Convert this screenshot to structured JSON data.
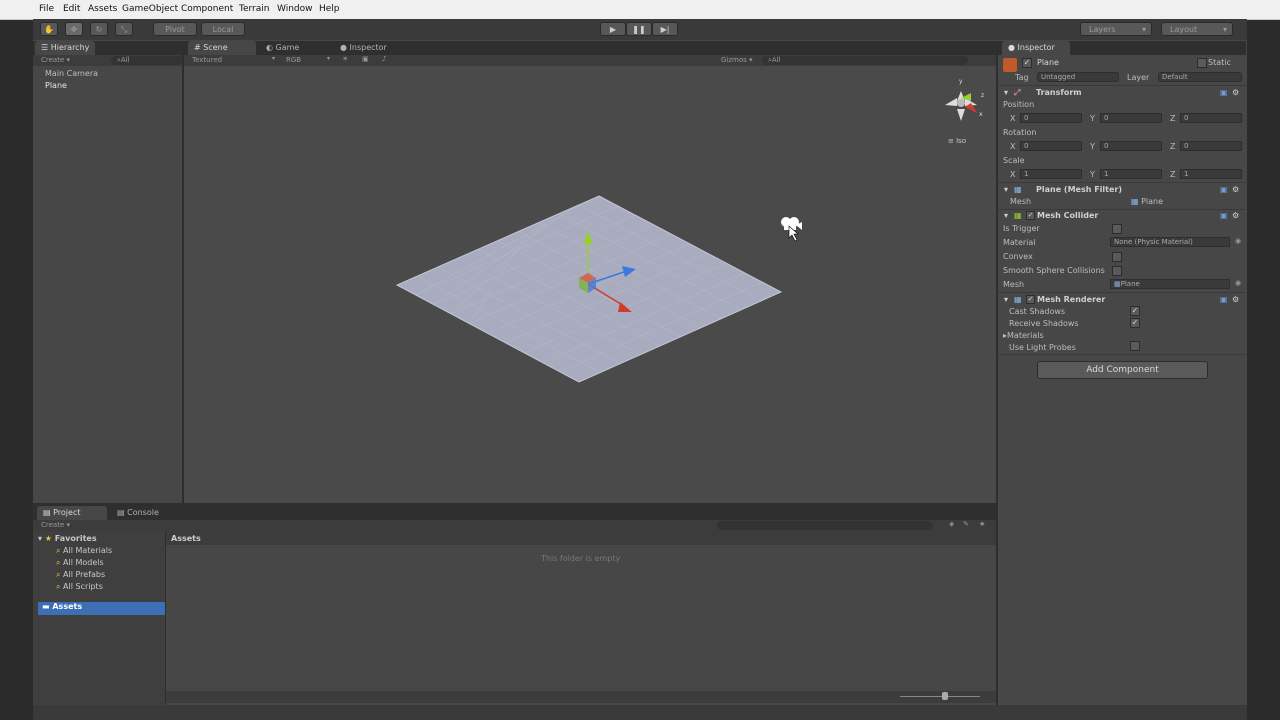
{
  "menu": [
    "File",
    "Edit",
    "Assets",
    "GameObject",
    "Component",
    "Terrain",
    "Window",
    "Help"
  ],
  "toolbar": {
    "pivot": "Pivot",
    "local": "Local",
    "layers": "Layers",
    "layout": "Layout"
  },
  "hierarchy": {
    "tab": "Hierarchy",
    "create": "Create",
    "search_placeholder": "All",
    "items": [
      "Main Camera",
      "Plane"
    ]
  },
  "scene": {
    "tabs": [
      "Scene",
      "Game",
      "Inspector"
    ],
    "shading": "Textured",
    "render_mode": "RGB",
    "gizmos": "Gizmos",
    "search_placeholder": "All",
    "iso": "Iso"
  },
  "inspector": {
    "tab": "Inspector",
    "object_name": "Plane",
    "static_label": "Static",
    "tag_label": "Tag",
    "tag_value": "Untagged",
    "layer_label": "Layer",
    "layer_value": "Default",
    "transform": {
      "title": "Transform",
      "position_label": "Position",
      "rotation_label": "Rotation",
      "scale_label": "Scale",
      "position": {
        "x": "0",
        "y": "0",
        "z": "0"
      },
      "rotation": {
        "x": "0",
        "y": "0",
        "z": "0"
      },
      "scale": {
        "x": "1",
        "y": "1",
        "z": "1"
      },
      "axis_x": "X",
      "axis_y": "Y",
      "axis_z": "Z"
    },
    "mesh_filter": {
      "title": "Plane (Mesh Filter)",
      "mesh_label": "Mesh",
      "mesh_value": "Plane"
    },
    "mesh_collider": {
      "title": "Mesh Collider",
      "is_trigger": "Is Trigger",
      "material": "Material",
      "material_value": "None (Physic Material)",
      "convex": "Convex",
      "smooth": "Smooth Sphere Collisions",
      "mesh": "Mesh",
      "mesh_value": "Plane"
    },
    "mesh_renderer": {
      "title": "Mesh Renderer",
      "cast_shadows": "Cast Shadows",
      "receive_shadows": "Receive Shadows",
      "materials": "Materials",
      "use_light_probes": "Use Light Probes"
    },
    "add_component": "Add Component"
  },
  "project": {
    "tabs": [
      "Project",
      "Console"
    ],
    "create": "Create",
    "favorites": "Favorites",
    "favorite_items": [
      "All Materials",
      "All Models",
      "All Prefabs",
      "All Scripts"
    ],
    "assets_root": "Assets",
    "assets_header": "Assets",
    "empty_msg": "This folder is empty"
  },
  "colors": {
    "accent_blue": "#3d6fb4",
    "axis_x": "#d13b2b",
    "axis_y": "#9acd32",
    "axis_z": "#3b78e0"
  }
}
